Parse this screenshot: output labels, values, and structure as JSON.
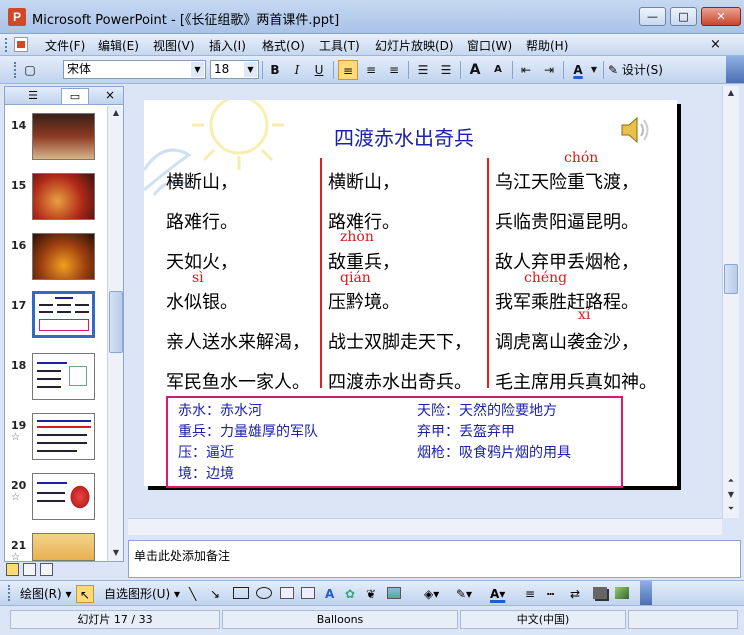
{
  "window": {
    "title": "Microsoft PowerPoint - [《长征组歌》两首课件.ppt]",
    "min": "—",
    "max": "□",
    "close": "✕"
  },
  "menu": {
    "items": [
      "文件(F)",
      "编辑(E)",
      "视图(V)",
      "插入(I)",
      "格式(O)",
      "工具(T)",
      "幻灯片放映(D)",
      "窗口(W)",
      "帮助(H)"
    ],
    "close": "×"
  },
  "toolbar": {
    "font_name": "宋体",
    "font_size": "18",
    "bold": "B",
    "italic": "I",
    "underline": "U",
    "grow_font": "A",
    "shrink_font": "A",
    "font_color": "A",
    "design_label": "设计(S)"
  },
  "slide_panel": {
    "slides": [
      {
        "num": "14",
        "star": ""
      },
      {
        "num": "15",
        "star": ""
      },
      {
        "num": "16",
        "star": ""
      },
      {
        "num": "17",
        "star": ""
      },
      {
        "num": "18",
        "star": ""
      },
      {
        "num": "19",
        "star": "☆"
      },
      {
        "num": "20",
        "star": "☆"
      },
      {
        "num": "21",
        "star": "☆"
      }
    ]
  },
  "slide": {
    "title": "四渡赤水出奇兵",
    "columns": [
      [
        "横断山，",
        "路难行。",
        "天如火，",
        "水似银。",
        "亲人送水来解渴，",
        "军民鱼水一家人。"
      ],
      [
        "横断山，",
        "路难行。",
        "敌重兵，",
        "压黔境。",
        "战士双脚走天下，",
        "四渡赤水出奇兵。"
      ],
      [
        "乌江天险重飞渡，",
        "兵临贵阳逼昆明。",
        "敌人弃甲丢烟枪，",
        "我军乘胜赶路程。",
        "调虎离山袭金沙，",
        "毛主席用兵真如神。"
      ]
    ],
    "pinyin": {
      "si": "sì",
      "zhong": "zhòn",
      "qian": "qián",
      "chong": "chón",
      "cheng": "chéng",
      "xi": "xí"
    },
    "notes": [
      "赤水：赤水河",
      "重兵：力量雄厚的军队",
      "压：逼近",
      "境：边境",
      "天险：天然的险要地方",
      "弃甲：丢盔弃甲",
      "烟枪：吸食鸦片烟的用具"
    ]
  },
  "notes_pane": {
    "placeholder": "单击此处添加备注"
  },
  "drawing_toolbar": {
    "draw_label": "绘图(R)",
    "autoshapes_label": "自选图形(U)"
  },
  "status": {
    "slide_info": "幻灯片 17 / 33",
    "template": "Balloons",
    "language": "中文(中国)"
  }
}
